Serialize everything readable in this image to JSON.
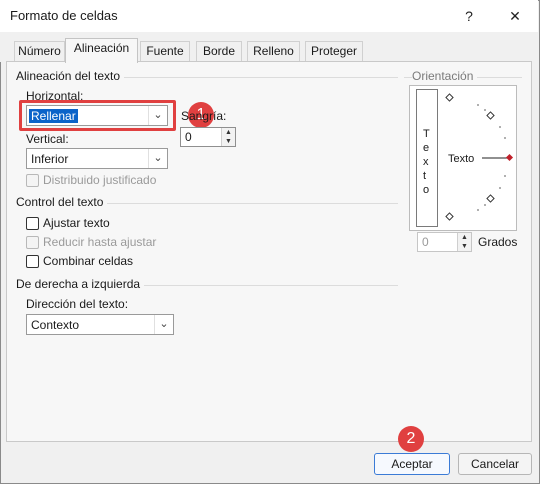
{
  "window": {
    "title": "Formato de celdas",
    "help_label": "?",
    "close_label": "✕"
  },
  "tabs": [
    {
      "label": "Número"
    },
    {
      "label": "Alineación",
      "active": true
    },
    {
      "label": "Fuente"
    },
    {
      "label": "Borde"
    },
    {
      "label": "Relleno"
    },
    {
      "label": "Proteger"
    }
  ],
  "alignment": {
    "section_label": "Alineación del texto",
    "horizontal_label": "Horizontal:",
    "horizontal_value": "Rellenar",
    "indent_label": "Sangría:",
    "indent_value": "0",
    "vertical_label": "Vertical:",
    "vertical_value": "Inferior",
    "distributed_label": "Distribuido justificado"
  },
  "text_control": {
    "section_label": "Control del texto",
    "wrap_label": "Ajustar texto",
    "shrink_label": "Reducir hasta ajustar",
    "merge_label": "Combinar celdas"
  },
  "rtl": {
    "section_label": "De derecha a izquierda",
    "direction_label": "Dirección del texto:",
    "direction_value": "Contexto"
  },
  "orientation": {
    "section_label": "Orientación",
    "vertical_text": [
      "T",
      "e",
      "x",
      "t",
      "o"
    ],
    "dial_text": "Texto",
    "degrees_value": "0",
    "degrees_label": "Grados"
  },
  "annotations": {
    "badge_1": "1",
    "badge_2": "2",
    "highlight_color": "#e04040"
  },
  "buttons": {
    "accept_label": "Aceptar",
    "cancel_label": "Cancelar"
  }
}
